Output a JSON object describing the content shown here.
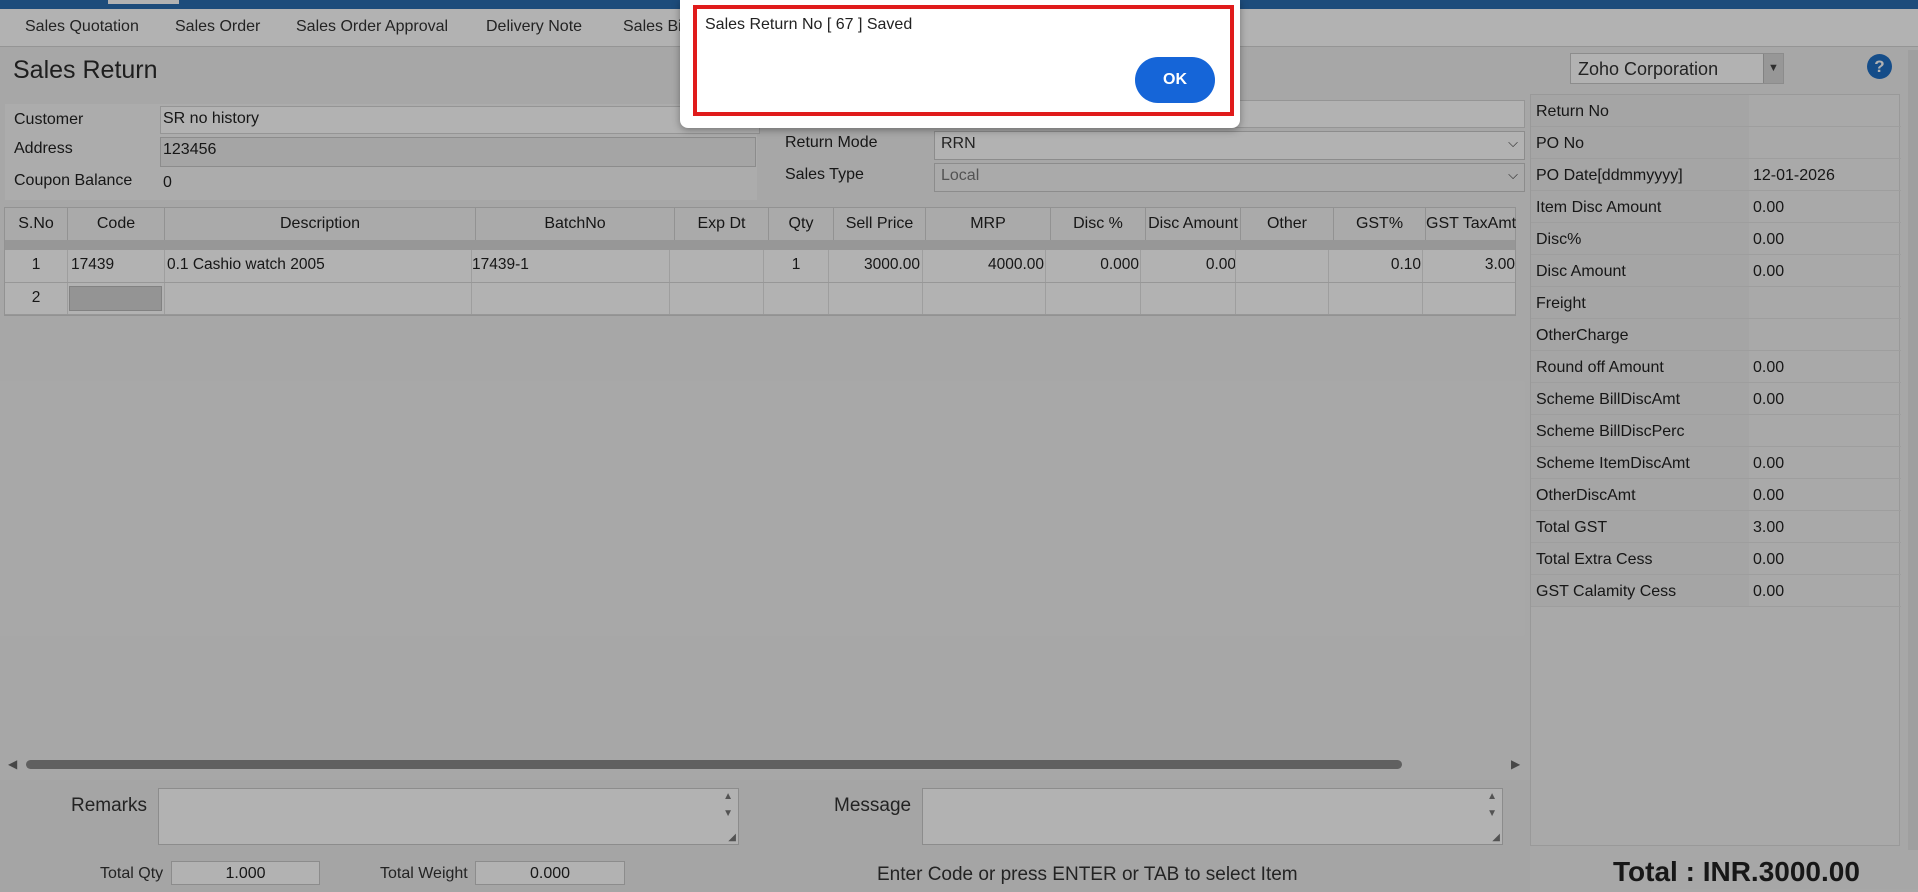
{
  "nav": {
    "items": [
      "Sales Quotation",
      "Sales Order",
      "Sales Order Approval",
      "Delivery Note",
      "Sales Bi"
    ]
  },
  "page_title": "Sales Return",
  "company": "Zoho Corporation",
  "help_glyph": "?",
  "customer_panel": {
    "customer_label": "Customer",
    "customer_value": "SR no history",
    "address_label": "Address",
    "address_value": "123456",
    "coupon_label": "Coupon Balance",
    "coupon_value": "0"
  },
  "return_panel": {
    "return_mode_label": "Return Mode",
    "return_mode_value": "RRN",
    "sales_type_label": "Sales Type",
    "sales_type_value": "Local"
  },
  "grid": {
    "headers": [
      "S.No",
      "Code",
      "Description",
      "BatchNo",
      "Exp Dt",
      "Qty",
      "Sell Price",
      "MRP",
      "Disc %",
      "Disc Amount",
      "Other",
      "GST%",
      "GST TaxAmt"
    ],
    "rows": [
      {
        "sno": "1",
        "code": "17439",
        "description": "0.1 Cashio watch 2005",
        "batch": "17439-1",
        "exp": "",
        "qty": "1",
        "sell_price": "3000.00",
        "mrp": "4000.00",
        "disc_pct": "0.000",
        "disc_amt": "0.00",
        "other": "",
        "gst_pct": "0.10",
        "gst_tax": "3.00"
      },
      {
        "sno": "2",
        "code": "",
        "description": "",
        "batch": "",
        "exp": "",
        "qty": "",
        "sell_price": "",
        "mrp": "",
        "disc_pct": "",
        "disc_amt": "",
        "other": "",
        "gst_pct": "",
        "gst_tax": ""
      }
    ]
  },
  "summary": [
    {
      "label": "Return No",
      "value": ""
    },
    {
      "label": "PO No",
      "value": ""
    },
    {
      "label": "PO Date[ddmmyyyy]",
      "value": "12-01-2026"
    },
    {
      "label": "Item Disc Amount",
      "value": "0.00"
    },
    {
      "label": "Disc%",
      "value": "0.00"
    },
    {
      "label": "Disc Amount",
      "value": "0.00"
    },
    {
      "label": "Freight",
      "value": ""
    },
    {
      "label": "OtherCharge",
      "value": ""
    },
    {
      "label": "Round off Amount",
      "value": "0.00"
    },
    {
      "label": "Scheme BillDiscAmt",
      "value": "0.00"
    },
    {
      "label": "Scheme BillDiscPerc",
      "value": ""
    },
    {
      "label": "Scheme ItemDiscAmt",
      "value": "0.00"
    },
    {
      "label": "OtherDiscAmt",
      "value": "0.00"
    },
    {
      "label": "Total GST",
      "value": "3.00"
    },
    {
      "label": "Total Extra Cess",
      "value": "0.00"
    },
    {
      "label": "GST Calamity Cess",
      "value": "0.00"
    }
  ],
  "footer": {
    "remarks_label": "Remarks",
    "message_label": "Message",
    "total_qty_label": "Total Qty",
    "total_qty_value": "1.000",
    "total_weight_label": "Total Weight",
    "total_weight_value": "0.000",
    "hint": "Enter Code or press ENTER or TAB to select Item",
    "total": "Total : INR.3000.00"
  },
  "dialog": {
    "message": "Sales Return No [ 67 ] Saved",
    "ok_label": "OK"
  },
  "colors": {
    "accent": "#1565d8",
    "highlight_border": "#e01b1b",
    "topbar": "#2a6db0"
  }
}
